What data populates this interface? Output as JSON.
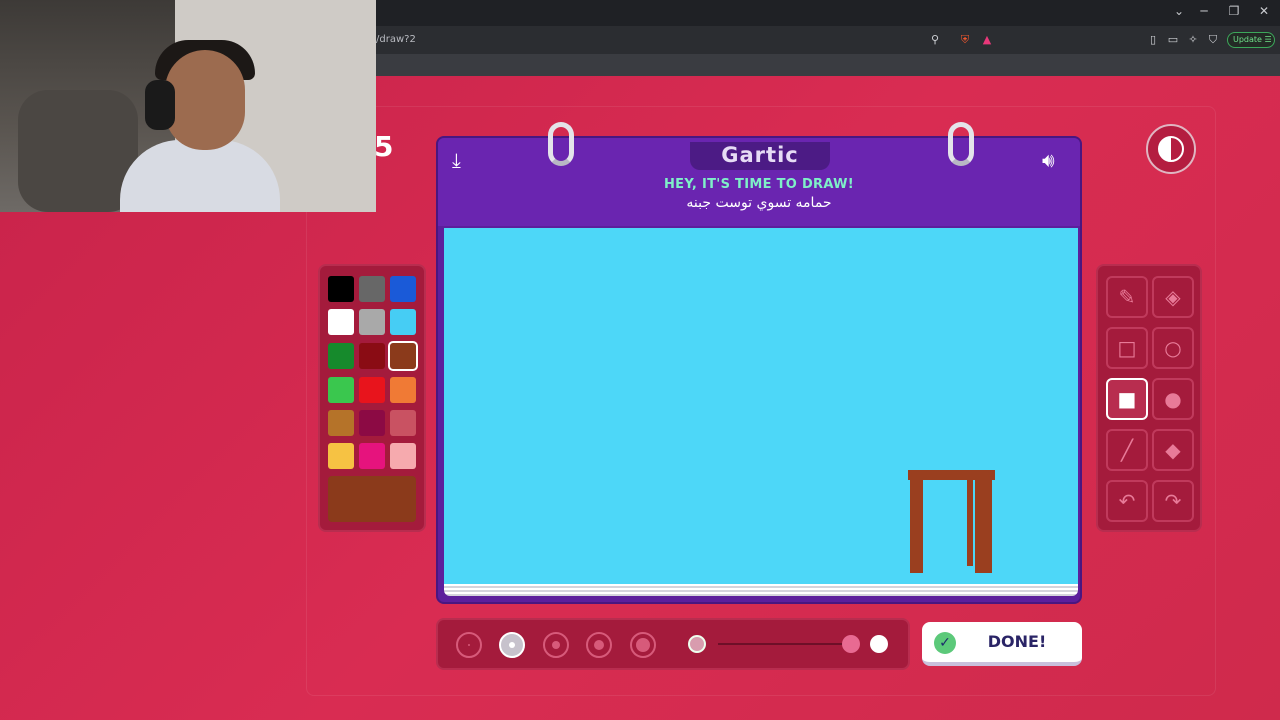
{
  "browser": {
    "url": "/draw?2",
    "update_label": "Update"
  },
  "game": {
    "logo": "Gartic",
    "prompt_heading": "HEY, IT'S TIME TO DRAW!",
    "prompt_word": "حمامه تسوي توست جبنه",
    "score_partial": "5",
    "done_label": "DONE!"
  },
  "palette": {
    "colors": [
      "#000000",
      "#676767",
      "#1a5ad8",
      "#ffffff",
      "#a9a9a9",
      "#46cdf4",
      "#168a2c",
      "#8a0c14",
      "#8b3a1b",
      "#3ac74e",
      "#e8141c",
      "#f07a35",
      "#b57329",
      "#8c0a44",
      "#c95262",
      "#f6c243",
      "#e6137d",
      "#f6aaae"
    ],
    "selected_color": "#8b3a1b"
  },
  "tools": [
    "pencil",
    "eraser",
    "rectangle",
    "ellipse",
    "filled-rectangle",
    "filled-ellipse",
    "line",
    "fill-bucket",
    "undo",
    "redo"
  ],
  "active_tool": "filled-rectangle",
  "brush_sizes": [
    "1",
    "2",
    "3",
    "4",
    "5"
  ],
  "active_brush": "2"
}
